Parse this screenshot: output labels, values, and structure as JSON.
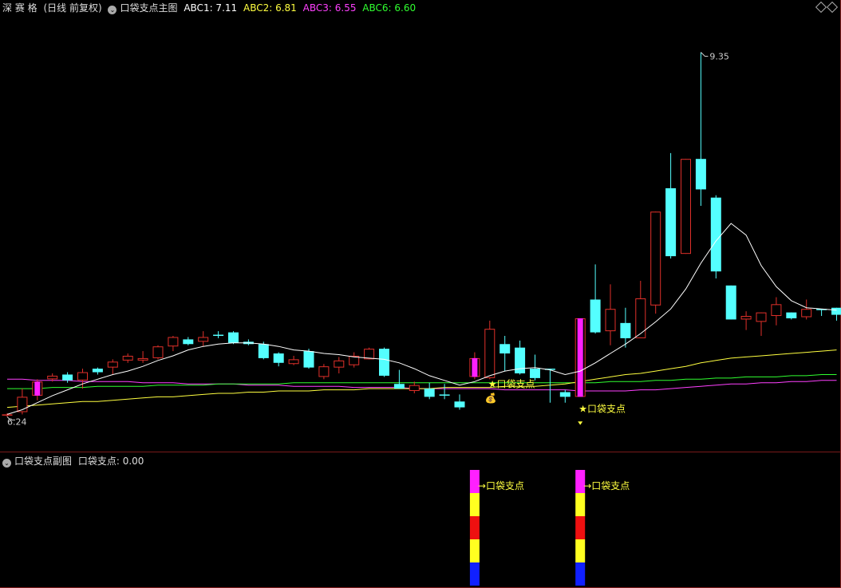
{
  "header": {
    "stock_name": "深 赛 格",
    "period": "(日线 前复权)",
    "indicator": "口袋支点主图",
    "abc1": "ABC1: 7.11",
    "abc2": "ABC2: 6.81",
    "abc3": "ABC3: 6.55",
    "abc6": "ABC6: 6.60"
  },
  "sub_header": {
    "indicator": "口袋支点副图",
    "value": "口袋支点: 0.00"
  },
  "colors": {
    "up": "#e0302a",
    "down": "#54ffff",
    "signal": "#ff20ff",
    "abc1": "#ffffff",
    "abc2": "#ffff40",
    "abc3": "#ff40ff",
    "abc6": "#30ff30",
    "label": "#ffff40"
  },
  "chart_data": {
    "type": "candlestick",
    "price_range": [
      5.97,
      9.66
    ],
    "max_label": "9.35",
    "min_label": "6.24",
    "candles": [
      {
        "o": 6.25,
        "c": 6.26,
        "h": 6.27,
        "l": 6.24,
        "s": "up"
      },
      {
        "o": 6.28,
        "c": 6.41,
        "h": 6.48,
        "l": 6.26,
        "s": "up"
      },
      {
        "o": 6.42,
        "c": 6.54,
        "h": 6.56,
        "l": 6.38,
        "s": "sig"
      },
      {
        "o": 6.56,
        "c": 6.59,
        "h": 6.61,
        "l": 6.54,
        "s": "up"
      },
      {
        "o": 6.6,
        "c": 6.55,
        "h": 6.62,
        "l": 6.53,
        "s": "down"
      },
      {
        "o": 6.55,
        "c": 6.62,
        "h": 6.65,
        "l": 6.48,
        "s": "up"
      },
      {
        "o": 6.62,
        "c": 6.65,
        "h": 6.66,
        "l": 6.6,
        "s": "down"
      },
      {
        "o": 6.66,
        "c": 6.71,
        "h": 6.73,
        "l": 6.6,
        "s": "up"
      },
      {
        "o": 6.72,
        "c": 6.76,
        "h": 6.78,
        "l": 6.7,
        "s": "up"
      },
      {
        "o": 6.72,
        "c": 6.74,
        "h": 6.8,
        "l": 6.7,
        "s": "up"
      },
      {
        "o": 6.74,
        "c": 6.84,
        "h": 6.85,
        "l": 6.73,
        "s": "up"
      },
      {
        "o": 6.84,
        "c": 6.92,
        "h": 6.93,
        "l": 6.8,
        "s": "up"
      },
      {
        "o": 6.9,
        "c": 6.86,
        "h": 6.92,
        "l": 6.85,
        "s": "down"
      },
      {
        "o": 6.88,
        "c": 6.92,
        "h": 6.97,
        "l": 6.84,
        "s": "up"
      },
      {
        "o": 6.94,
        "c": 6.93,
        "h": 6.97,
        "l": 6.91,
        "s": "down"
      },
      {
        "o": 6.96,
        "c": 6.87,
        "h": 6.97,
        "l": 6.86,
        "s": "down"
      },
      {
        "o": 6.88,
        "c": 6.86,
        "h": 6.9,
        "l": 6.85,
        "s": "down"
      },
      {
        "o": 6.86,
        "c": 6.74,
        "h": 6.88,
        "l": 6.73,
        "s": "down"
      },
      {
        "o": 6.78,
        "c": 6.7,
        "h": 6.79,
        "l": 6.67,
        "s": "down"
      },
      {
        "o": 6.69,
        "c": 6.73,
        "h": 6.76,
        "l": 6.68,
        "s": "up"
      },
      {
        "o": 6.8,
        "c": 6.66,
        "h": 6.82,
        "l": 6.65,
        "s": "down"
      },
      {
        "o": 6.58,
        "c": 6.67,
        "h": 6.69,
        "l": 6.56,
        "s": "up"
      },
      {
        "o": 6.66,
        "c": 6.72,
        "h": 6.75,
        "l": 6.61,
        "s": "up"
      },
      {
        "o": 6.68,
        "c": 6.76,
        "h": 6.79,
        "l": 6.66,
        "s": "up"
      },
      {
        "o": 6.73,
        "c": 6.82,
        "h": 6.83,
        "l": 6.73,
        "s": "up"
      },
      {
        "o": 6.82,
        "c": 6.59,
        "h": 6.83,
        "l": 6.58,
        "s": "down"
      },
      {
        "o": 6.52,
        "c": 6.48,
        "h": 6.64,
        "l": 6.48,
        "s": "down"
      },
      {
        "o": 6.46,
        "c": 6.51,
        "h": 6.54,
        "l": 6.44,
        "s": "up"
      },
      {
        "o": 6.48,
        "c": 6.41,
        "h": 6.53,
        "l": 6.39,
        "s": "down"
      },
      {
        "o": 6.43,
        "c": 6.42,
        "h": 6.52,
        "l": 6.39,
        "s": "down"
      },
      {
        "o": 6.37,
        "c": 6.32,
        "h": 6.43,
        "l": 6.3,
        "s": "down"
      },
      {
        "o": 6.58,
        "c": 6.74,
        "h": 6.79,
        "l": 6.56,
        "s": "sig"
      },
      {
        "o": 6.57,
        "c": 6.99,
        "h": 7.06,
        "l": 6.56,
        "s": "up"
      },
      {
        "o": 6.86,
        "c": 6.78,
        "h": 6.93,
        "l": 6.63,
        "s": "down"
      },
      {
        "o": 6.83,
        "c": 6.61,
        "h": 6.89,
        "l": 6.6,
        "s": "down"
      },
      {
        "o": 6.65,
        "c": 6.57,
        "h": 6.77,
        "l": 6.55,
        "s": "down"
      },
      {
        "o": 6.65,
        "c": 6.65,
        "h": 6.65,
        "l": 6.36,
        "s": "down"
      },
      {
        "o": 6.45,
        "c": 6.41,
        "h": 6.47,
        "l": 6.36,
        "s": "down"
      },
      {
        "o": 6.41,
        "c": 7.08,
        "h": 7.08,
        "l": 6.41,
        "s": "sig"
      },
      {
        "o": 7.24,
        "c": 6.96,
        "h": 7.54,
        "l": 6.95,
        "s": "down"
      },
      {
        "o": 6.97,
        "c": 7.16,
        "h": 7.37,
        "l": 6.85,
        "s": "up"
      },
      {
        "o": 7.04,
        "c": 6.91,
        "h": 7.17,
        "l": 6.83,
        "s": "down"
      },
      {
        "o": 6.91,
        "c": 7.25,
        "h": 7.4,
        "l": 6.91,
        "s": "up"
      },
      {
        "o": 7.19,
        "c": 7.99,
        "h": 7.99,
        "l": 7.12,
        "s": "up"
      },
      {
        "o": 8.19,
        "c": 7.61,
        "h": 8.49,
        "l": 7.59,
        "s": "down"
      },
      {
        "o": 7.63,
        "c": 8.44,
        "h": 8.44,
        "l": 7.63,
        "s": "up"
      },
      {
        "o": 8.44,
        "c": 8.18,
        "h": 9.35,
        "l": 8.04,
        "s": "down"
      },
      {
        "o": 8.11,
        "c": 7.48,
        "h": 8.13,
        "l": 7.42,
        "s": "down"
      },
      {
        "o": 7.36,
        "c": 7.07,
        "h": 7.36,
        "l": 7.07,
        "s": "down"
      },
      {
        "o": 7.07,
        "c": 7.1,
        "h": 7.14,
        "l": 6.98,
        "s": "up"
      },
      {
        "o": 7.05,
        "c": 7.13,
        "h": 7.13,
        "l": 6.93,
        "s": "up"
      },
      {
        "o": 7.1,
        "c": 7.2,
        "h": 7.26,
        "l": 7.02,
        "s": "up"
      },
      {
        "o": 7.13,
        "c": 7.08,
        "h": 7.13,
        "l": 7.07,
        "s": "down"
      },
      {
        "o": 7.09,
        "c": 7.16,
        "h": 7.24,
        "l": 7.07,
        "s": "up"
      },
      {
        "o": 7.16,
        "c": 7.16,
        "h": 7.16,
        "l": 7.1,
        "s": "down"
      },
      {
        "o": 7.17,
        "c": 7.11,
        "h": 7.17,
        "l": 7.06,
        "s": "down"
      }
    ],
    "abc1": [
      6.26,
      6.3,
      6.36,
      6.42,
      6.47,
      6.52,
      6.56,
      6.6,
      6.63,
      6.67,
      6.72,
      6.76,
      6.81,
      6.84,
      6.86,
      6.87,
      6.87,
      6.86,
      6.84,
      6.81,
      6.8,
      6.78,
      6.77,
      6.75,
      6.74,
      6.73,
      6.7,
      6.65,
      6.59,
      6.55,
      6.51,
      6.54,
      6.59,
      6.63,
      6.65,
      6.66,
      6.64,
      6.6,
      6.63,
      6.7,
      6.78,
      6.86,
      6.95,
      7.05,
      7.16,
      7.33,
      7.55,
      7.74,
      7.89,
      7.79,
      7.53,
      7.35,
      7.23,
      7.17,
      7.16,
      7.15
    ],
    "abc2": [
      6.32,
      6.33,
      6.34,
      6.35,
      6.36,
      6.37,
      6.37,
      6.38,
      6.39,
      6.4,
      6.41,
      6.41,
      6.42,
      6.43,
      6.44,
      6.44,
      6.45,
      6.45,
      6.46,
      6.46,
      6.46,
      6.47,
      6.47,
      6.47,
      6.48,
      6.48,
      6.48,
      6.48,
      6.48,
      6.49,
      6.49,
      6.49,
      6.49,
      6.5,
      6.5,
      6.5,
      6.51,
      6.52,
      6.54,
      6.56,
      6.58,
      6.6,
      6.61,
      6.63,
      6.65,
      6.67,
      6.7,
      6.72,
      6.74,
      6.75,
      6.76,
      6.77,
      6.78,
      6.79,
      6.8,
      6.81
    ],
    "abc3": [
      6.56,
      6.56,
      6.55,
      6.55,
      6.55,
      6.54,
      6.54,
      6.54,
      6.54,
      6.53,
      6.53,
      6.53,
      6.52,
      6.52,
      6.52,
      6.52,
      6.51,
      6.51,
      6.51,
      6.5,
      6.5,
      6.5,
      6.5,
      6.49,
      6.49,
      6.49,
      6.49,
      6.48,
      6.48,
      6.48,
      6.48,
      6.48,
      6.48,
      6.47,
      6.47,
      6.47,
      6.47,
      6.47,
      6.46,
      6.46,
      6.46,
      6.46,
      6.47,
      6.47,
      6.48,
      6.49,
      6.5,
      6.51,
      6.52,
      6.52,
      6.53,
      6.53,
      6.54,
      6.54,
      6.55,
      6.55
    ],
    "abc6": [
      6.48,
      6.48,
      6.48,
      6.49,
      6.49,
      6.49,
      6.5,
      6.5,
      6.5,
      6.5,
      6.51,
      6.51,
      6.51,
      6.51,
      6.52,
      6.52,
      6.52,
      6.52,
      6.52,
      6.53,
      6.53,
      6.53,
      6.53,
      6.53,
      6.53,
      6.53,
      6.53,
      6.53,
      6.53,
      6.53,
      6.53,
      6.53,
      6.53,
      6.53,
      6.53,
      6.53,
      6.53,
      6.53,
      6.53,
      6.53,
      6.54,
      6.54,
      6.54,
      6.55,
      6.55,
      6.56,
      6.56,
      6.57,
      6.57,
      6.58,
      6.58,
      6.58,
      6.59,
      6.59,
      6.6,
      6.6
    ],
    "labels": [
      {
        "text": "★口袋支点",
        "candle": 32,
        "price": 6.49
      },
      {
        "text": "★口袋支点",
        "candle": 38,
        "price": 6.28
      }
    ],
    "money_icon": {
      "text": "💰",
      "candle": 32,
      "price": 6.37
    },
    "pocket_bars": [
      {
        "candle": 31,
        "text": "→口袋支点",
        "colors": [
          "#ff20ff",
          "#ffff20",
          "#ee1010",
          "#ffff20",
          "#1020ff"
        ]
      },
      {
        "candle": 38,
        "text": "→口袋支点",
        "colors": [
          "#ff20ff",
          "#ffff20",
          "#ee1010",
          "#ffff20",
          "#1020ff"
        ]
      }
    ]
  }
}
